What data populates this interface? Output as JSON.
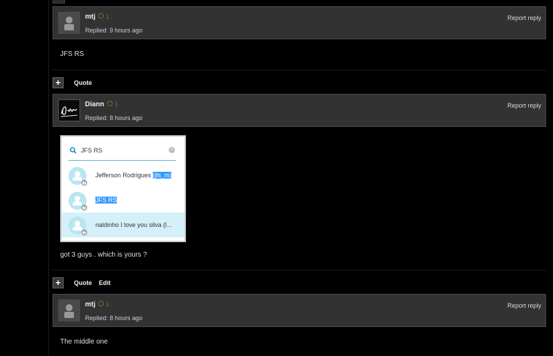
{
  "posts": [
    {
      "username": "mtj",
      "reputation": "1",
      "replied": "Replied: 9 hours ago",
      "report_label": "Report reply",
      "body": "JFS RS",
      "actions": [
        "Quote"
      ]
    },
    {
      "username": "Diann",
      "reputation": "1",
      "replied": "Replied: 8 hours ago",
      "report_label": "Report reply",
      "body": "got 3 guys . which is yours ?",
      "actions": [
        "Quote",
        "Edit"
      ],
      "embedded_search": {
        "query": "JFS RS",
        "results": [
          {
            "name": "Jefferson Rodrigues",
            "handle": "(jfs_rs)"
          },
          {
            "name": "JFS RS"
          },
          {
            "name": "naldinho I love you silva (l..."
          }
        ]
      }
    },
    {
      "username": "mtj",
      "reputation": "1",
      "replied": "Replied: 8 hours ago",
      "report_label": "Report reply",
      "body": "The middle one"
    }
  ],
  "icons": {
    "expand": "plus-icon",
    "avatar": "user-icon",
    "search": "search-icon",
    "clear": "clear-icon"
  },
  "colors": {
    "background": "#000000",
    "header": "#323232",
    "reputation": "#5a7a3a",
    "selection": "#3399ff",
    "highlight_row": "#d4f1f9"
  }
}
